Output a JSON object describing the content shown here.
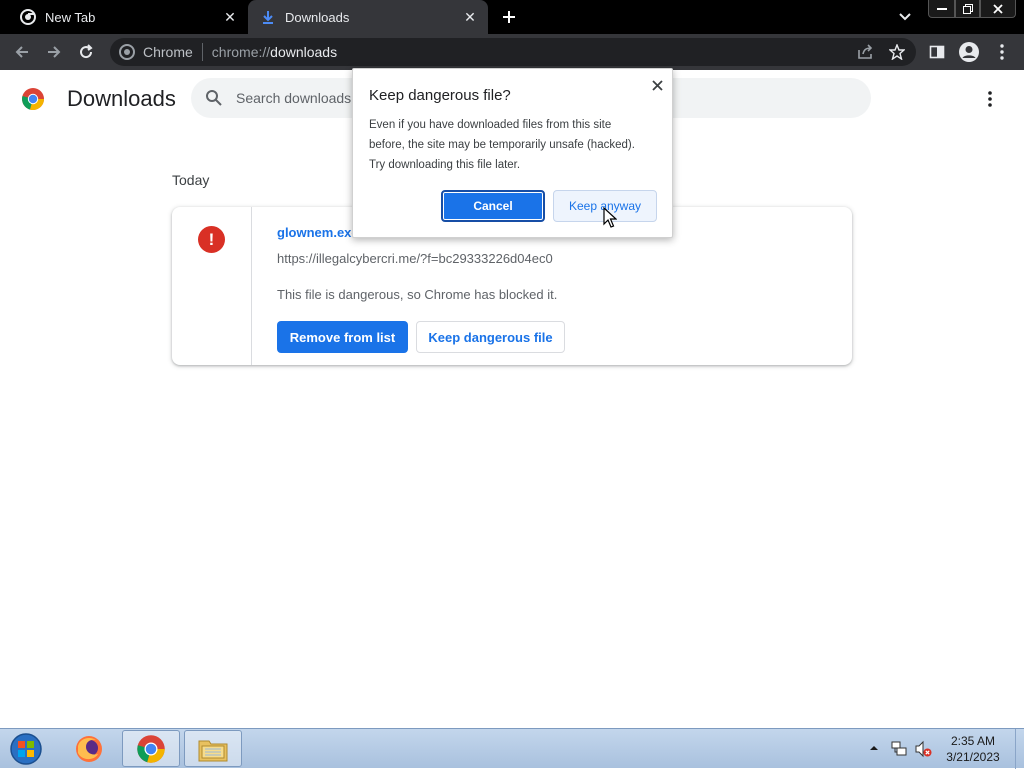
{
  "browser": {
    "tabs": [
      {
        "title": "New Tab"
      },
      {
        "title": "Downloads"
      }
    ],
    "omnibox": {
      "site_label": "Chrome",
      "url_scheme": "chrome://",
      "url_host": "downloads"
    }
  },
  "page": {
    "title": "Downloads",
    "search_placeholder": "Search downloads",
    "date_heading": "Today",
    "download": {
      "file_name": "glownem.exe",
      "url": "https://illegalcybercri.me/?f=bc29333226d04ec0",
      "status": "This file is dangerous, so Chrome has blocked it.",
      "remove_label": "Remove from list",
      "keep_label": "Keep dangerous file"
    }
  },
  "dialog": {
    "title": "Keep dangerous file?",
    "body_lines": [
      "Even if you have downloaded files from this site",
      "before, the site may be temporarily unsafe (hacked).",
      "Try downloading this file later."
    ],
    "cancel_label": "Cancel",
    "keep_label": "Keep anyway"
  },
  "taskbar": {
    "time": "2:35 AM",
    "date": "3/21/2023"
  },
  "colors": {
    "accent": "#1a73e8",
    "danger": "#d93025"
  }
}
